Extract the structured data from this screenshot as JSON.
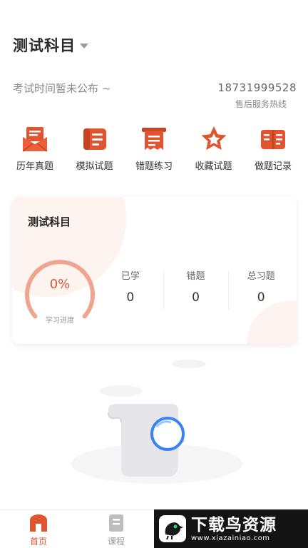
{
  "header": {
    "subject_title": "测试科目",
    "exam_time_text": "考试时间暂未公布 ~",
    "hotline_phone": "18731999528",
    "hotline_label": "售后服务热线"
  },
  "quick_menu": [
    {
      "label": "历年真题",
      "icon": "envelope-icon"
    },
    {
      "label": "模拟试题",
      "icon": "document-icon"
    },
    {
      "label": "错题练习",
      "icon": "receipt-icon"
    },
    {
      "label": "收藏试题",
      "icon": "star-icon"
    },
    {
      "label": "做题记录",
      "icon": "book-icon"
    }
  ],
  "progress_card": {
    "title": "测试科目",
    "progress_percent_text": "0%",
    "progress_value": 0,
    "progress_label": "学习进度",
    "stats": [
      {
        "label": "已学",
        "value": "0"
      },
      {
        "label": "错题",
        "value": "0"
      },
      {
        "label": "总习题",
        "value": "0"
      }
    ]
  },
  "tab_bar": {
    "home_label": "首页",
    "course_label": "课程"
  },
  "watermark": {
    "title": "下载鸟资源",
    "url": "www.xiazainiao.com"
  },
  "colors": {
    "accent": "#e0552f",
    "gauge_track": "#f0a48e",
    "empty_ring": "#3b82f6"
  }
}
